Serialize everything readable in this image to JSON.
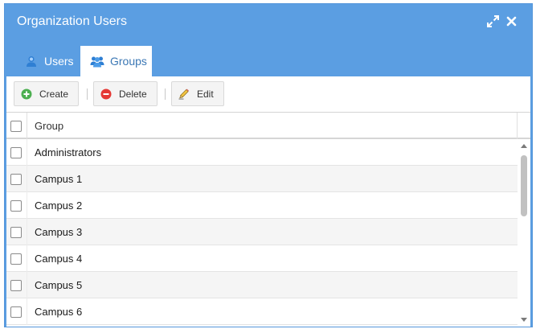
{
  "window": {
    "title": "Organization Users",
    "tools": [
      {
        "name": "maximize-icon"
      },
      {
        "name": "close-icon"
      }
    ]
  },
  "tabs": [
    {
      "label": "Users",
      "icon": "user-icon",
      "active": false
    },
    {
      "label": "Groups",
      "icon": "group-icon",
      "active": true
    }
  ],
  "toolbar": {
    "create_label": "Create",
    "delete_label": "Delete",
    "edit_label": "Edit"
  },
  "grid": {
    "column_header": "Group",
    "rows": [
      {
        "group": "Administrators"
      },
      {
        "group": "Campus 1"
      },
      {
        "group": "Campus 2"
      },
      {
        "group": "Campus 3"
      },
      {
        "group": "Campus 4"
      },
      {
        "group": "Campus 5"
      },
      {
        "group": "Campus 6"
      }
    ]
  },
  "colors": {
    "header": "#5b9ee2",
    "active_tab_text": "#3c78b5",
    "create_icon": "#4caf50",
    "delete_icon": "#e53935"
  }
}
